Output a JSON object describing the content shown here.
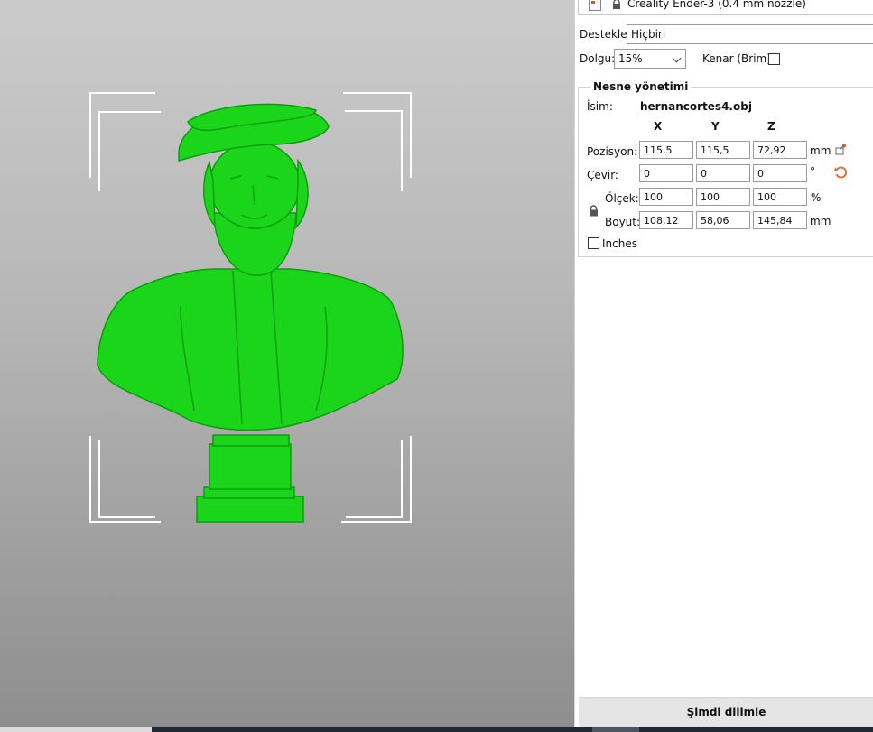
{
  "printer": {
    "name": "Creality Ender-3 (0.4 mm nozzle)"
  },
  "settings": {
    "supports_label": "Destekler:",
    "supports_value": "Hiçbiri",
    "infill_label": "Dolgu:",
    "infill_value": "15%",
    "brim_label": "Kenar (Brim):",
    "brim_checked": false
  },
  "object_manipulation": {
    "title": "Nesne yönetimi",
    "name_label": "İsim:",
    "name_value": "hernancortes4.obj",
    "axes": [
      "X",
      "Y",
      "Z"
    ],
    "rows": [
      {
        "label": "Pozisyon:",
        "values": [
          "115,5",
          "115,5",
          "72,92"
        ],
        "unit": "mm"
      },
      {
        "label": "Çevir:",
        "values": [
          "0",
          "0",
          "0"
        ],
        "unit": "°"
      },
      {
        "label": "Ölçek:",
        "values": [
          "100",
          "100",
          "100"
        ],
        "unit": "%"
      },
      {
        "label": "Boyut:",
        "values": [
          "108,12",
          "58,06",
          "145,84"
        ],
        "unit": "mm"
      }
    ],
    "inches_label": "Inches",
    "inches_checked": false
  },
  "slice_button_label": "Şimdi dilimle",
  "model": {
    "color": "#1bd51b",
    "shadow": "#0b9e0b"
  },
  "icons": [
    "printer-settings-icon",
    "lock-icon",
    "drop-to-bed-icon",
    "reset-rotation-icon",
    "scale-lock-icon"
  ]
}
